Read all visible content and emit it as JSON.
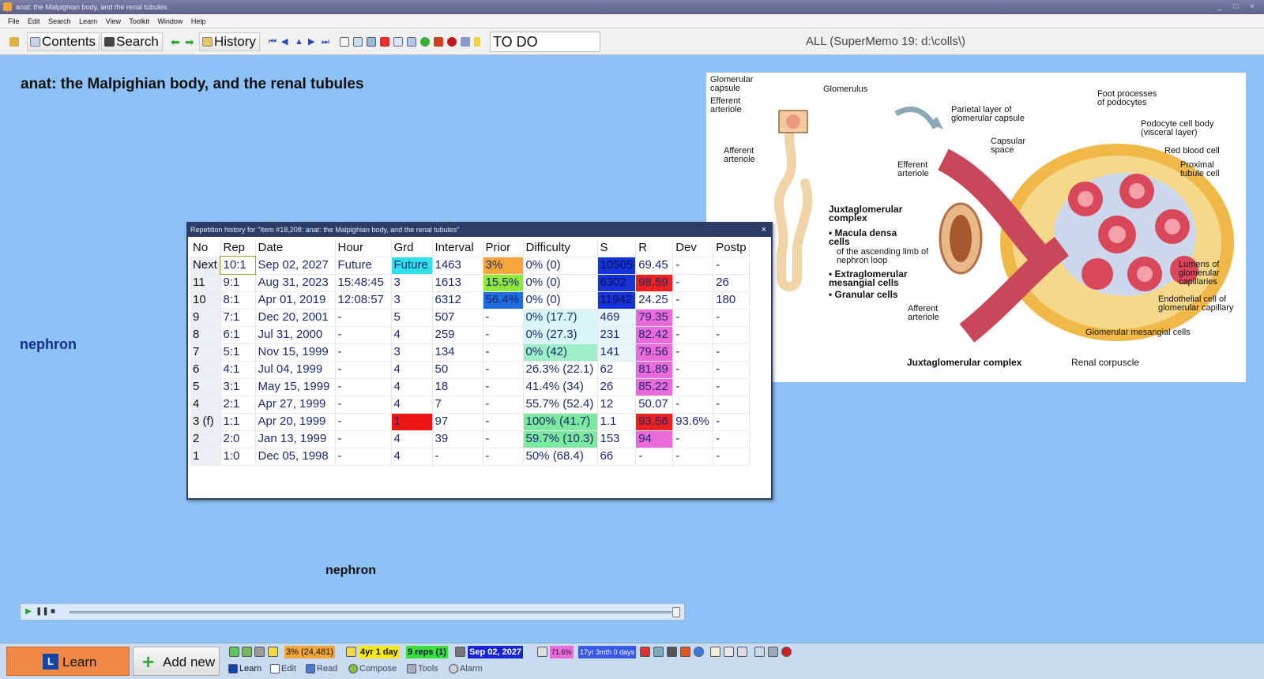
{
  "window": {
    "title": "anat: the Malpighian body, and the renal tubules",
    "buttons": "_ □ ×"
  },
  "menu": [
    "File",
    "Edit",
    "Search",
    "Learn",
    "View",
    "Toolkit",
    "Window",
    "Help"
  ],
  "toolbar": {
    "contents_label": "Contents",
    "search_label": "Search",
    "history_label": "History",
    "todo_value": "TO DO",
    "collection_status": "ALL (SuperMemo 19: d:\\colls\\)"
  },
  "element": {
    "title": "anat: the Malpighian body, and the renal tubules",
    "side_label": "nephron",
    "bottom_label": "nephron"
  },
  "image": {
    "labels": {
      "glomerular_capsule": "Glomerular capsule",
      "efferent_arteriole": "Efferent arteriole",
      "glomerulus": "Glomerulus",
      "afferent_arteriole": "Afferent arteriole",
      "parietal_layer": "Parietal layer of glomerular capsule",
      "capsular_space": "Capsular space",
      "efferent_arteriole_2": "Efferent arteriole",
      "foot_processes": "Foot processes of podocytes",
      "podocyte_body": "Podocyte cell body (visceral layer)",
      "red_blood_cell": "Red blood cell",
      "proximal_tubule": "Proximal tubule cell",
      "jg_complex": "Juxtaglomerular complex",
      "macula_densa": "• Macula densa cells",
      "ascending_limb": "of the ascending limb of nephron loop",
      "extraglomerular": "• Extraglomerular mesangial cells",
      "granular": "• Granular cells",
      "afferent_arteriole_2": "Afferent arteriole",
      "lumens": "Lumens of glomerular capillaries",
      "endothelial": "Endothelial cell of glomerular capillary",
      "mesangial": "Glomerular mesangial cells",
      "jg_complex_bottom": "Juxtaglomerular complex",
      "renal_corpuscle": "Renal corpuscle"
    }
  },
  "history_dialog": {
    "title": "Repetition history for \"Item #18,208: anat: the Malpighian body, and the renal tubules\"",
    "close": "×",
    "columns": [
      "No",
      "Rep",
      "Date",
      "Hour",
      "Grd",
      "Interval",
      "Prior",
      "Difficulty",
      "S",
      "R",
      "Dev",
      "Postp"
    ],
    "rows": [
      {
        "no": "Next",
        "rep": "10:1",
        "date": "Sep 02, 2027",
        "hour": "Future",
        "grd": "Future",
        "interval": "1463",
        "prior": "3%",
        "difficulty": "0% (0)",
        "s": "10505",
        "r": "69.45",
        "dev": "-",
        "postp": "-"
      },
      {
        "no": "11",
        "rep": "9:1",
        "date": "Aug 31, 2023",
        "hour": "15:48:45",
        "grd": "3",
        "interval": "1613",
        "prior": "15.5%",
        "difficulty": "0% (0)",
        "s": "6302",
        "r": "98.59",
        "dev": "-",
        "postp": "26"
      },
      {
        "no": "10",
        "rep": "8:1",
        "date": "Apr 01, 2019",
        "hour": "12:08:57",
        "grd": "3",
        "interval": "6312",
        "prior": "56.4%",
        "difficulty": "0% (0)",
        "s": "11942",
        "r": "24.25",
        "dev": "-",
        "postp": "180"
      },
      {
        "no": "9",
        "rep": "7:1",
        "date": "Dec 20, 2001",
        "hour": "-",
        "grd": "5",
        "interval": "507",
        "prior": "-",
        "difficulty": "0% (17.7)",
        "s": "469",
        "r": "79.35",
        "dev": "-",
        "postp": "-"
      },
      {
        "no": "8",
        "rep": "6:1",
        "date": "Jul 31, 2000",
        "hour": "-",
        "grd": "4",
        "interval": "259",
        "prior": "-",
        "difficulty": "0% (27.3)",
        "s": "231",
        "r": "82.42",
        "dev": "-",
        "postp": "-"
      },
      {
        "no": "7",
        "rep": "5:1",
        "date": "Nov 15, 1999",
        "hour": "-",
        "grd": "3",
        "interval": "134",
        "prior": "-",
        "difficulty": "0% (42)",
        "s": "141",
        "r": "79.56",
        "dev": "-",
        "postp": "-"
      },
      {
        "no": "6",
        "rep": "4:1",
        "date": "Jul 04, 1999",
        "hour": "-",
        "grd": "4",
        "interval": "50",
        "prior": "-",
        "difficulty": "26.3% (22.1)",
        "s": "62",
        "r": "81.89",
        "dev": "-",
        "postp": "-"
      },
      {
        "no": "5",
        "rep": "3:1",
        "date": "May 15, 1999",
        "hour": "-",
        "grd": "4",
        "interval": "18",
        "prior": "-",
        "difficulty": "41.4% (34)",
        "s": "26",
        "r": "85.22",
        "dev": "-",
        "postp": "-"
      },
      {
        "no": "4",
        "rep": "2:1",
        "date": "Apr 27, 1999",
        "hour": "-",
        "grd": "4",
        "interval": "7",
        "prior": "-",
        "difficulty": "55.7% (52.4)",
        "s": "12",
        "r": "50.07",
        "dev": "-",
        "postp": "-"
      },
      {
        "no": "3 (f)",
        "rep": "1:1",
        "date": "Apr 20, 1999",
        "hour": "-",
        "grd": "1",
        "interval": "97",
        "prior": "-",
        "difficulty": "100% (41.7)",
        "s": "1.1",
        "r": "93.56",
        "dev": "93.6%",
        "postp": "-"
      },
      {
        "no": "2",
        "rep": "2:0",
        "date": "Jan 13, 1999",
        "hour": "-",
        "grd": "4",
        "interval": "39",
        "prior": "-",
        "difficulty": "59.7% (10.3)",
        "s": "153",
        "r": "94",
        "dev": "-",
        "postp": "-"
      },
      {
        "no": "1",
        "rep": "1:0",
        "date": "Dec 05, 1998",
        "hour": "-",
        "grd": "4",
        "interval": "-",
        "prior": "-",
        "difficulty": "50% (68.4)",
        "s": "66",
        "r": "-",
        "dev": "-",
        "postp": "-"
      }
    ],
    "cell_colors": {
      "future": "#2ee0e8",
      "prior_next": "#f4a63a",
      "prior_15": "#8de83a",
      "prior_56": "#1f6be0",
      "s_strong": "#1533d8",
      "r_red": "#ee2020",
      "r_pink": "#ea6ad9",
      "difficulty_light": "#d8f6f8",
      "difficulty_mid": "#9eefc8",
      "difficulty_green": "#7de8a0",
      "grade_fail": "#ee1515",
      "s_light": "#e6f6f8"
    }
  },
  "statusbar": {
    "learn_label": "Learn",
    "add_new_label": "Add new",
    "prior_stat": "3% (24,481)",
    "interval_stat": "4yr 1 day",
    "reps_stat": "9 reps (1)",
    "next_date": "Sep 02, 2027",
    "retention": "71.6%",
    "age": "17yr 3mth 0 days",
    "tabs": [
      "Learn",
      "Edit",
      "Read",
      "Compose",
      "Tools",
      "Alarm"
    ]
  }
}
